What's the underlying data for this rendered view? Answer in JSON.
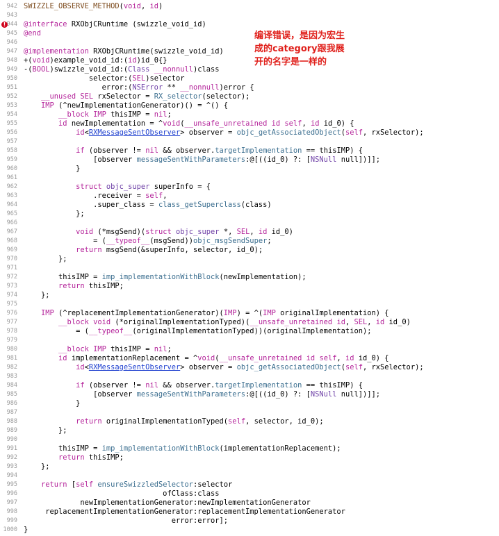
{
  "annotation": {
    "lines": [
      "编译错误，是因为宏生",
      "成的category跟我展",
      "开的名字是一样的"
    ],
    "color": "#e0201b"
  },
  "error_line": 944,
  "lines": [
    {
      "n": "942",
      "t": "SWIZZLE_OBSERVE_METHOD(void, id)"
    },
    {
      "n": "943",
      "t": ""
    },
    {
      "n": "944",
      "t": "@interface RXObjCRuntime (swizzle_void_id)"
    },
    {
      "n": "945",
      "t": "@end"
    },
    {
      "n": "946",
      "t": ""
    },
    {
      "n": "947",
      "t": "@implementation RXObjCRuntime(swizzle_void_id)"
    },
    {
      "n": "948",
      "t": "+(void)example_void_id:(id)id_0{}"
    },
    {
      "n": "949",
      "t": "-(BOOL)swizzle_void_id:(Class __nonnull)class"
    },
    {
      "n": "950",
      "t": "               selector:(SEL)selector"
    },
    {
      "n": "951",
      "t": "                  error:(NSError ** __nonnull)error {"
    },
    {
      "n": "952",
      "t": "    __unused SEL rxSelector = RX_selector(selector);"
    },
    {
      "n": "953",
      "t": "    IMP (^newImplementationGenerator)() = ^() {"
    },
    {
      "n": "954",
      "t": "        __block IMP thisIMP = nil;"
    },
    {
      "n": "955",
      "t": "        id newImplementation = ^void(__unsafe_unretained id self, id id_0) {"
    },
    {
      "n": "956",
      "t": "            id<RXMessageSentObserver> observer = objc_getAssociatedObject(self, rxSelector);"
    },
    {
      "n": "957",
      "t": ""
    },
    {
      "n": "958",
      "t": "            if (observer != nil && observer.targetImplementation == thisIMP) {"
    },
    {
      "n": "959",
      "t": "                [observer messageSentWithParameters:@[((id_0) ?: [NSNull null])]];"
    },
    {
      "n": "960",
      "t": "            }"
    },
    {
      "n": "961",
      "t": ""
    },
    {
      "n": "962",
      "t": "            struct objc_super superInfo = {"
    },
    {
      "n": "963",
      "t": "                .receiver = self,"
    },
    {
      "n": "964",
      "t": "                .super_class = class_getSuperclass(class)"
    },
    {
      "n": "965",
      "t": "            };"
    },
    {
      "n": "966",
      "t": ""
    },
    {
      "n": "967",
      "t": "            void (*msgSend)(struct objc_super *, SEL, id id_0)"
    },
    {
      "n": "968",
      "t": "                = (__typeof__(msgSend))objc_msgSendSuper;"
    },
    {
      "n": "969",
      "t": "            return msgSend(&superInfo, selector, id_0);"
    },
    {
      "n": "970",
      "t": "        };"
    },
    {
      "n": "971",
      "t": ""
    },
    {
      "n": "972",
      "t": "        thisIMP = imp_implementationWithBlock(newImplementation);"
    },
    {
      "n": "973",
      "t": "        return thisIMP;"
    },
    {
      "n": "974",
      "t": "    };"
    },
    {
      "n": "975",
      "t": ""
    },
    {
      "n": "976",
      "t": "    IMP (^replacementImplementationGenerator)(IMP) = ^(IMP originalImplementation) {"
    },
    {
      "n": "977",
      "t": "        __block void (*originalImplementationTyped)(__unsafe_unretained id, SEL, id id_0)"
    },
    {
      "n": "978",
      "t": "            = (__typeof__(originalImplementationTyped))(originalImplementation);"
    },
    {
      "n": "979",
      "t": ""
    },
    {
      "n": "980",
      "t": "        __block IMP thisIMP = nil;"
    },
    {
      "n": "981",
      "t": "        id implementationReplacement = ^void(__unsafe_unretained id self, id id_0) {"
    },
    {
      "n": "982",
      "t": "            id<RXMessageSentObserver> observer = objc_getAssociatedObject(self, rxSelector);"
    },
    {
      "n": "983",
      "t": ""
    },
    {
      "n": "984",
      "t": "            if (observer != nil && observer.targetImplementation == thisIMP) {"
    },
    {
      "n": "985",
      "t": "                [observer messageSentWithParameters:@[((id_0) ?: [NSNull null])]];"
    },
    {
      "n": "986",
      "t": "            }"
    },
    {
      "n": "987",
      "t": ""
    },
    {
      "n": "988",
      "t": "            return originalImplementationTyped(self, selector, id_0);"
    },
    {
      "n": "989",
      "t": "        };"
    },
    {
      "n": "990",
      "t": ""
    },
    {
      "n": "991",
      "t": "        thisIMP = imp_implementationWithBlock(implementationReplacement);"
    },
    {
      "n": "992",
      "t": "        return thisIMP;"
    },
    {
      "n": "993",
      "t": "    };"
    },
    {
      "n": "994",
      "t": ""
    },
    {
      "n": "995",
      "t": "    return [self ensureSwizzledSelector:selector"
    },
    {
      "n": "996",
      "t": "                                ofClass:class"
    },
    {
      "n": "997",
      "t": "             newImplementationGenerator:newImplementationGenerator"
    },
    {
      "n": "998",
      "t": "     replacementImplementationGenerator:replacementImplementationGenerator"
    },
    {
      "n": "999",
      "t": "                                  error:error];"
    },
    {
      "n": "1000",
      "t": "}"
    }
  ]
}
